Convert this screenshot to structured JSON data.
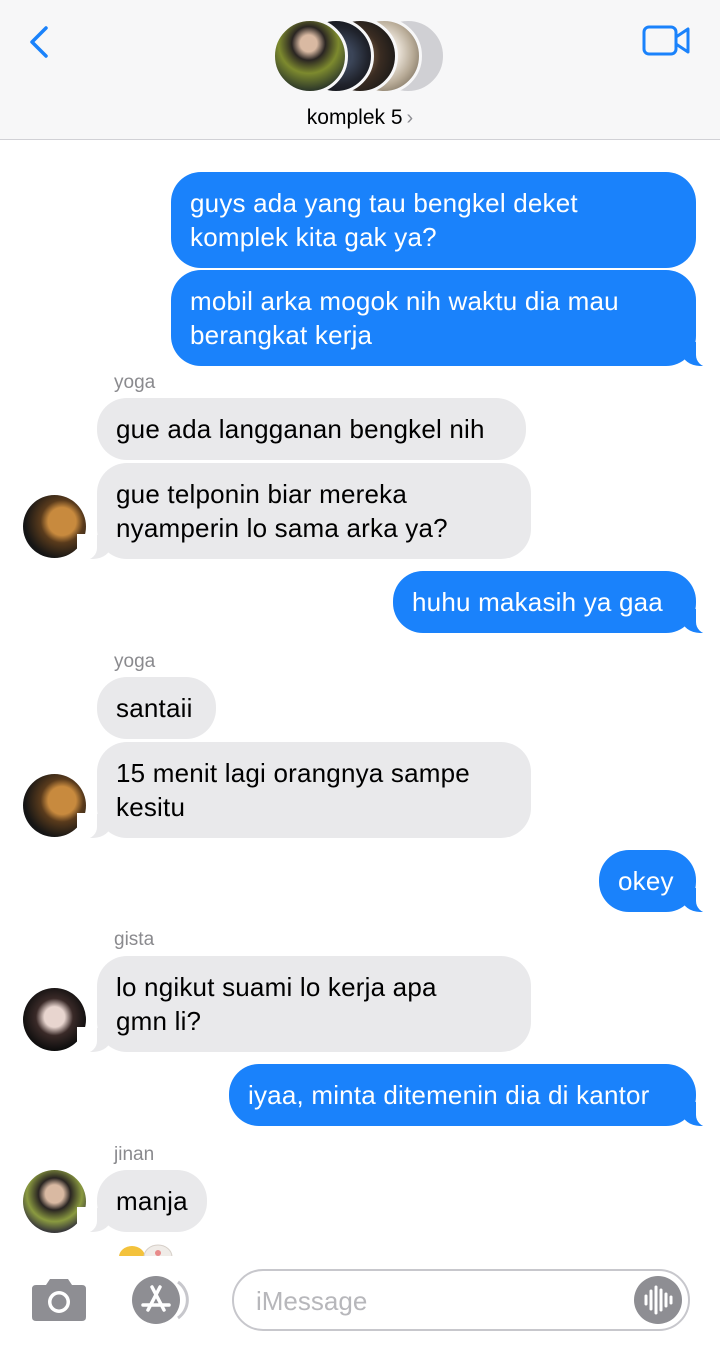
{
  "header": {
    "group_name": "komplek 5",
    "chevron": "›"
  },
  "messages": [
    {
      "sender": "",
      "text_lines": [
        "guys ada yang tau bengkel deket",
        "komplek kita gak ya?"
      ],
      "direction": "outgoing"
    },
    {
      "sender": "",
      "text_lines": [
        "mobil arka mogok nih waktu dia mau",
        "berangkat kerja"
      ],
      "direction": "outgoing"
    },
    {
      "sender": "yoga",
      "text_lines": [
        "gue ada langganan bengkel nih"
      ],
      "direction": "incoming"
    },
    {
      "sender": "yoga",
      "text_lines": [
        "gue telponin biar mereka",
        "nyamperin lo sama arka ya?"
      ],
      "direction": "incoming"
    },
    {
      "sender": "",
      "text_lines": [
        "huhu makasih ya gaa"
      ],
      "direction": "outgoing"
    },
    {
      "sender": "yoga",
      "text_lines": [
        "santaii"
      ],
      "direction": "incoming"
    },
    {
      "sender": "yoga",
      "text_lines": [
        "15 menit lagi orangnya sampe",
        "kesitu"
      ],
      "direction": "incoming"
    },
    {
      "sender": "",
      "text_lines": [
        "okey"
      ],
      "direction": "outgoing"
    },
    {
      "sender": "gista",
      "text_lines": [
        "lo ngikut suami lo kerja apa",
        "gmn li?"
      ],
      "direction": "incoming"
    },
    {
      "sender": "",
      "text_lines": [
        "iyaa, minta ditemenin dia di kantor"
      ],
      "direction": "outgoing"
    },
    {
      "sender": "jinan",
      "text_lines": [
        "manja"
      ],
      "direction": "incoming"
    }
  ],
  "input": {
    "placeholder": "iMessage",
    "value": ""
  },
  "icons": {
    "back": "chevron-left-icon",
    "video": "video-camera-icon",
    "camera": "camera-icon",
    "apps": "app-store-icon",
    "audio": "audio-waveform-icon"
  },
  "colors": {
    "outgoing_bubble": "#1a82fb",
    "incoming_bubble": "#e9e9eb",
    "accent": "#1a82fb",
    "secondary_text": "#8a8a8e"
  }
}
